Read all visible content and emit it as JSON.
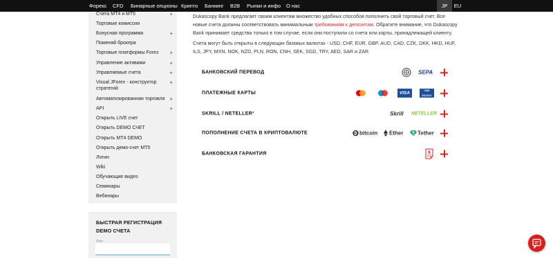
{
  "topnav": {
    "items": [
      "Форекс",
      "CFD",
      "Бинарные опционы",
      "Крипто",
      "Банкинг",
      "B2B",
      "Рынки и инфо",
      "О нас"
    ],
    "langs": [
      "JP",
      "EU"
    ]
  },
  "sidebar": {
    "items": [
      {
        "label": "Счета MT4 и MT5",
        "plus": "+"
      },
      {
        "label": "Торговые комиссии",
        "plus": ""
      },
      {
        "label": "Бонусная программа",
        "plus": "+"
      },
      {
        "label": "Поменяй брокера",
        "plus": ""
      },
      {
        "label": "Торговые платформы Forex",
        "plus": "+"
      },
      {
        "label": "Управление активами",
        "plus": "+"
      },
      {
        "label": "Управляемые счета",
        "plus": "+"
      },
      {
        "label": "Visual JForex - конструктор стратегий",
        "plus": "+"
      },
      {
        "label": "Автоматизированная торговля",
        "plus": "+"
      },
      {
        "label": "API",
        "plus": "+"
      },
      {
        "label": "Открыть LIVE счет",
        "plus": ""
      },
      {
        "label": "Открыть DEMO СЧЕТ",
        "plus": ""
      },
      {
        "label": "Открыть MT4 DEMO",
        "plus": ""
      },
      {
        "label": "Открыть демо-счет MT5",
        "plus": ""
      },
      {
        "label": "Логин",
        "plus": ""
      },
      {
        "label": "Wiki",
        "plus": ""
      },
      {
        "label": "Обучающие видео",
        "plus": ""
      },
      {
        "label": "Семинары",
        "plus": ""
      },
      {
        "label": "Вебинары",
        "plus": ""
      }
    ]
  },
  "registration": {
    "title": "БЫСТРАЯ РЕГИСТРАЦИЯ DEMO СЧЕТА",
    "name_label": "Имя",
    "name_value": ""
  },
  "content": {
    "para1_a": "Dukascopy Bank предлагает своим клиентам множество удобных способов пополнить свой торговый счет. Все новые счета должны соответствовать минимальным ",
    "para1_link": "требованиям к депозитам",
    "para1_b": ". Обратите внимание, что Dukascopy Bank принимает средства только в том случае, если они поступили со счета или карты, принадлежащей клиенту.",
    "para2": "Счета могут быть открыты в следующих базовых валютах - USD, CHF, EUR, GBP, AUD, CAD, CZK, DKK, HKD, HUF, ILS, JPY, MXN, NOK, NZD, PLN, RON, CNH, SEK, SGD, TRY, AED, SAR и ZAR"
  },
  "methods": [
    {
      "label": "БАНКОВСКИЙ ПЕРЕВОД",
      "logos": [
        "swift",
        "SEPA"
      ]
    },
    {
      "label": "ПЛАТЕЖНЫЕ КАРТЫ",
      "logos": [
        "mastercard",
        "maestro",
        "VISA",
        "VISA Electron"
      ]
    },
    {
      "label": "SKRILL / NETELLER³",
      "logos": [
        "Skrill",
        "NETELLER"
      ]
    },
    {
      "label": "ПОПОЛНЕНИЕ СЧЕТА В КРИПТОВАЛЮТЕ",
      "logos": [
        "bitcoin",
        "Ether",
        "Tether"
      ]
    },
    {
      "label": "БАНКОВСКАЯ ГАРАНТИЯ",
      "logos": [
        "guarantee-document-icon"
      ]
    }
  ],
  "colors": {
    "accent": "#e0201b",
    "link": "#d32f2f",
    "nav_bg": "#111111",
    "sidebar_bg": "#f1f1f1",
    "sepa_blue": "#1b3fa0",
    "visa_blue": "#1a4e9a",
    "tether_teal": "#26a17b",
    "neteller_green": "#8bc53f"
  },
  "chat": {
    "icon": "chat-icon"
  }
}
